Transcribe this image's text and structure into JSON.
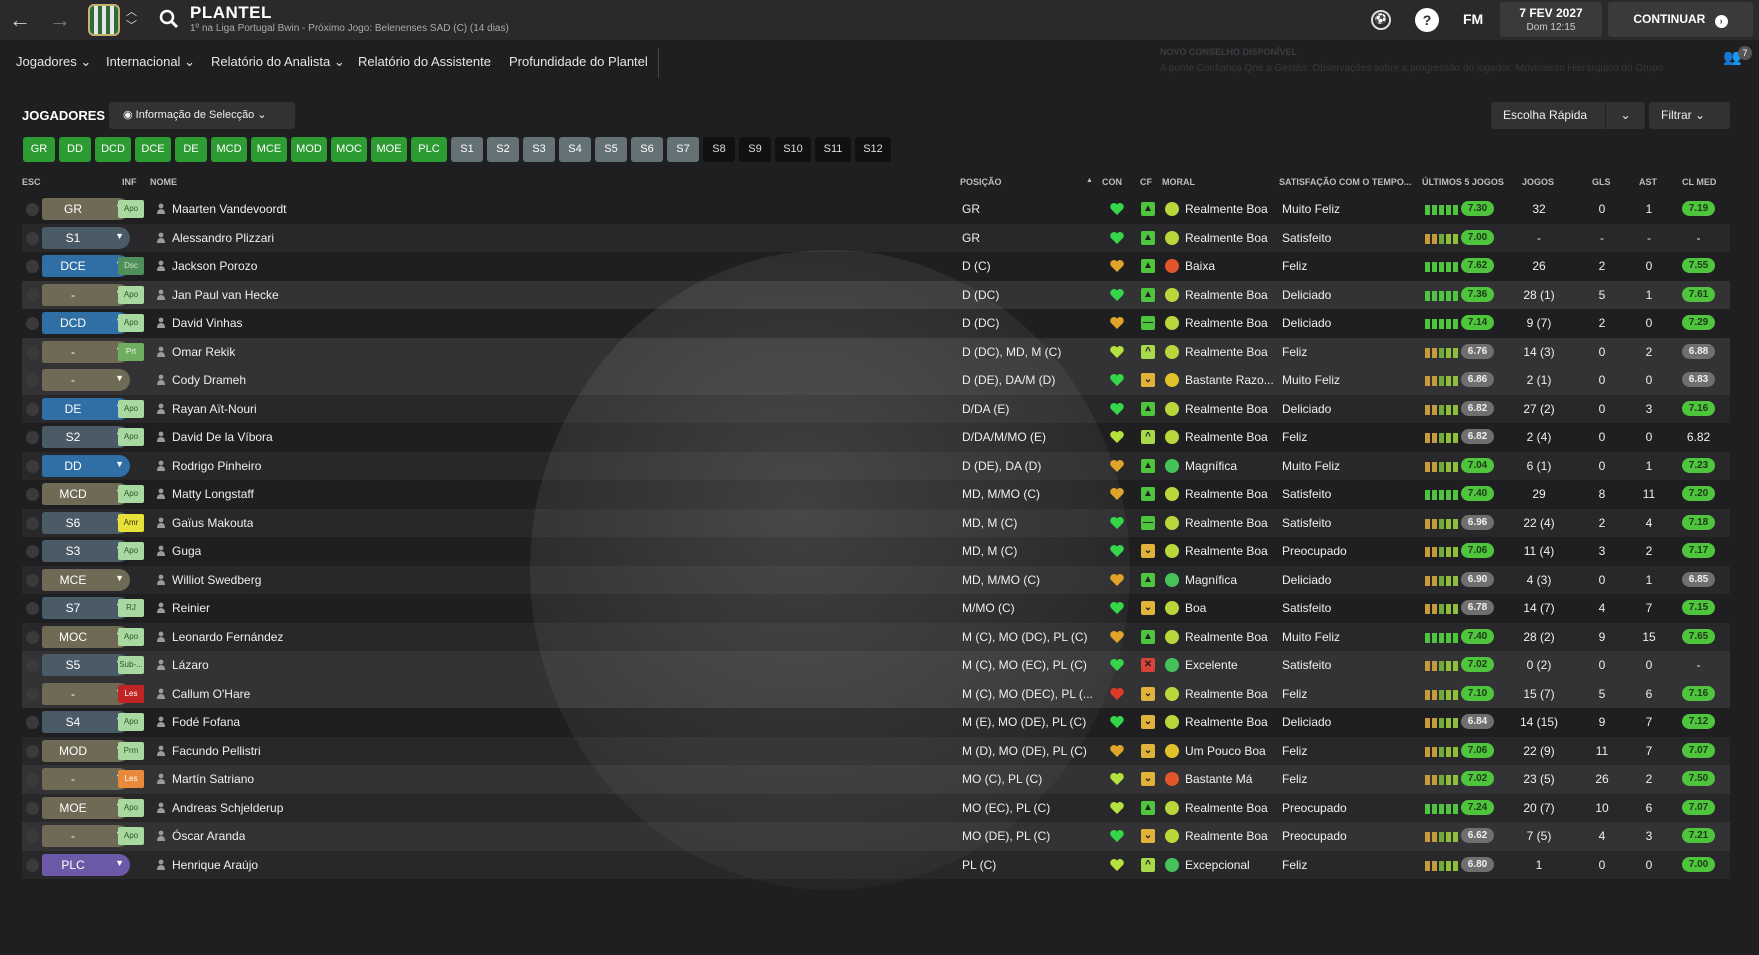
{
  "header": {
    "title": "PLANTEL",
    "subtitle": "1º na Liga Portugal Bwin - Próximo Jogo: Belenenses SAD (C) (14 dias)",
    "fm_label": "FM",
    "date": "7 FEV 2027",
    "day_time": "Dom 12:15",
    "continue_label": "CONTINUAR"
  },
  "menu": {
    "items": [
      "Jogadores",
      "Internacional",
      "Relatório do Analista",
      "Relatório do Assistente",
      "Profundidade do Plantel"
    ]
  },
  "news": {
    "title": "NOVO CONSELHO DISPONÍVEL",
    "text": "A ponte Confiança Qne a Gestão. Observações sobre a progressão do jogador: Movimento Hierárquico do Grupo",
    "badge": "7"
  },
  "players_section": {
    "title": "JOGADORES",
    "view_label": "Informação de Selecção",
    "quick_pick": "Escolha Rápida",
    "filter": "Filtrar"
  },
  "chips": {
    "green": [
      "GR",
      "DD",
      "DCD",
      "DCE",
      "DE",
      "MCD",
      "MCE",
      "MOD",
      "MOC",
      "MOE",
      "PLC"
    ],
    "grey": [
      "S1",
      "S2",
      "S3",
      "S4",
      "S5",
      "S6",
      "S7"
    ],
    "dark": [
      "S8",
      "S9",
      "S10",
      "S11",
      "S12"
    ]
  },
  "columns": {
    "esc": "ESC",
    "inf": "INF",
    "nome": "NOME",
    "posicao": "POSIÇÃO",
    "con": "CON",
    "cf": "CF",
    "moral": "MORAL",
    "satisfacao": "SATISFAÇÃO COM O TEMPO...",
    "ultimos": "ÚLTIMOS 5 JOGOS",
    "jogos": "JOGOS",
    "gls": "GLS",
    "ast": "AST",
    "clmed": "CL MED"
  },
  "colors": {
    "green": "#2c9c33",
    "blue": "#2f6fa5",
    "olive": "#6f6a55",
    "slate": "#4a5a66",
    "purple": "#6c5aa8",
    "rating_green": "#4fc53d",
    "rating_grey": "#6f6f6f"
  },
  "players": [
    {
      "sel": "GR",
      "sel_color": "olive",
      "inf": "Apo",
      "inf_type": "apo",
      "name": "Maarten Vandevoordt",
      "pos": "GR",
      "con": "green",
      "cf": "up",
      "moral_icon": "ok",
      "moral": "Realmente Boa",
      "sat": "Muito Feliz",
      "form": "g5",
      "avg5": "7.30",
      "avg5_type": "green",
      "jogos": "32",
      "gls": "0",
      "ast": "1",
      "cl": "7.19",
      "cl_type": "green"
    },
    {
      "sel": "S1",
      "sel_color": "slate",
      "inf": "",
      "inf_type": "",
      "name": "Alessandro Plizzari",
      "pos": "GR",
      "con": "green",
      "cf": "up",
      "moral_icon": "ok",
      "moral": "Realmente Boa",
      "sat": "Satisfeito",
      "form": "o5",
      "avg5": "7.00",
      "avg5_type": "green",
      "jogos": "-",
      "gls": "-",
      "ast": "-",
      "cl": "-",
      "cl_type": "none"
    },
    {
      "sel": "DCE",
      "sel_color": "blue",
      "inf": "Dsc",
      "inf_type": "dsc",
      "name": "Jackson Porozo",
      "pos": "D (C)",
      "con": "orange",
      "cf": "up",
      "moral_icon": "bad",
      "moral": "Baixa",
      "sat": "Feliz",
      "form": "g5",
      "avg5": "7.62",
      "avg5_type": "green",
      "jogos": "26",
      "gls": "2",
      "ast": "0",
      "cl": "7.55",
      "cl_type": "green"
    },
    {
      "sel": "-",
      "sel_color": "olive",
      "inf": "Apo",
      "inf_type": "apo",
      "name": "Jan Paul van Hecke",
      "pos": "D (DC)",
      "con": "green",
      "cf": "up",
      "moral_icon": "ok",
      "moral": "Realmente Boa",
      "sat": "Deliciado",
      "form": "g5",
      "avg5": "7.36",
      "avg5_type": "green",
      "jogos": "28 (1)",
      "gls": "5",
      "ast": "1",
      "cl": "7.61",
      "cl_type": "green"
    },
    {
      "sel": "DCD",
      "sel_color": "blue",
      "inf": "Apo",
      "inf_type": "apo",
      "name": "David Vinhas",
      "pos": "D (DC)",
      "con": "orange",
      "cf": "flat",
      "moral_icon": "ok",
      "moral": "Realmente Boa",
      "sat": "Deliciado",
      "form": "g5",
      "avg5": "7.14",
      "avg5_type": "green",
      "jogos": "9 (7)",
      "gls": "2",
      "ast": "0",
      "cl": "7.29",
      "cl_type": "green"
    },
    {
      "sel": "-",
      "sel_color": "olive",
      "inf": "Prt",
      "inf_type": "prt",
      "name": "Omar Rekik",
      "pos": "D (DC), MD, M (C)",
      "con": "lime",
      "cf": "upcaret",
      "moral_icon": "ok",
      "moral": "Realmente Boa",
      "sat": "Feliz",
      "form": "o5",
      "avg5": "6.76",
      "avg5_type": "grey",
      "jogos": "14 (3)",
      "gls": "0",
      "ast": "2",
      "cl": "6.88",
      "cl_type": "grey"
    },
    {
      "sel": "-",
      "sel_color": "olive",
      "inf": "",
      "inf_type": "",
      "name": "Cody Drameh",
      "pos": "D (DE), DA/M (D)",
      "con": "green",
      "cf": "down",
      "moral_icon": "meh",
      "moral": "Bastante Razo...",
      "sat": "Muito Feliz",
      "form": "o5",
      "avg5": "6.86",
      "avg5_type": "grey",
      "jogos": "2 (1)",
      "gls": "0",
      "ast": "0",
      "cl": "6.83",
      "cl_type": "grey"
    },
    {
      "sel": "DE",
      "sel_color": "blue",
      "inf": "Apo",
      "inf_type": "apo",
      "name": "Rayan Aït-Nouri",
      "pos": "D/DA (E)",
      "con": "green",
      "cf": "up",
      "moral_icon": "ok",
      "moral": "Realmente Boa",
      "sat": "Deliciado",
      "form": "o5",
      "avg5": "6.82",
      "avg5_type": "grey",
      "jogos": "27 (2)",
      "gls": "0",
      "ast": "3",
      "cl": "7.16",
      "cl_type": "green"
    },
    {
      "sel": "S2",
      "sel_color": "slate",
      "inf": "Apo",
      "inf_type": "apo",
      "name": "David De la Víbora",
      "pos": "D/DA/M/MO (E)",
      "con": "lime",
      "cf": "upcaret",
      "moral_icon": "ok",
      "moral": "Realmente Boa",
      "sat": "Feliz",
      "form": "o5",
      "avg5": "6.82",
      "avg5_type": "grey",
      "jogos": "2 (4)",
      "gls": "0",
      "ast": "0",
      "cl": "6.82",
      "cl_type": "plain"
    },
    {
      "sel": "DD",
      "sel_color": "blue",
      "inf": "",
      "inf_type": "",
      "name": "Rodrigo Pinheiro",
      "pos": "D (DE), DA (D)",
      "con": "orange",
      "cf": "up",
      "moral_icon": "great",
      "moral": "Magnífica",
      "sat": "Muito Feliz",
      "form": "o5",
      "avg5": "7.04",
      "avg5_type": "green",
      "jogos": "6 (1)",
      "gls": "0",
      "ast": "1",
      "cl": "7.23",
      "cl_type": "green"
    },
    {
      "sel": "MCD",
      "sel_color": "olive",
      "inf": "Apo",
      "inf_type": "apo",
      "name": "Matty Longstaff",
      "pos": "MD, M/MO (C)",
      "con": "orange",
      "cf": "up",
      "moral_icon": "ok",
      "moral": "Realmente Boa",
      "sat": "Satisfeito",
      "form": "g5",
      "avg5": "7.40",
      "avg5_type": "green",
      "jogos": "29",
      "gls": "8",
      "ast": "11",
      "cl": "7.20",
      "cl_type": "green"
    },
    {
      "sel": "S6",
      "sel_color": "slate",
      "inf": "Amr",
      "inf_type": "amr",
      "name": "Gaïus Makouta",
      "pos": "MD, M (C)",
      "con": "green",
      "cf": "flat",
      "moral_icon": "ok",
      "moral": "Realmente Boa",
      "sat": "Satisfeito",
      "form": "o5",
      "avg5": "6.96",
      "avg5_type": "grey",
      "jogos": "22 (4)",
      "gls": "2",
      "ast": "4",
      "cl": "7.18",
      "cl_type": "green"
    },
    {
      "sel": "S3",
      "sel_color": "slate",
      "inf": "Apo",
      "inf_type": "apo",
      "name": "Guga",
      "pos": "MD, M (C)",
      "con": "green",
      "cf": "down",
      "moral_icon": "ok",
      "moral": "Realmente Boa",
      "sat": "Preocupado",
      "form": "o5",
      "avg5": "7.06",
      "avg5_type": "green",
      "jogos": "11 (4)",
      "gls": "3",
      "ast": "2",
      "cl": "7.17",
      "cl_type": "green"
    },
    {
      "sel": "MCE",
      "sel_color": "olive",
      "inf": "",
      "inf_type": "",
      "name": "Williot Swedberg",
      "pos": "MD, M/MO (C)",
      "con": "orange",
      "cf": "up",
      "moral_icon": "great",
      "moral": "Magnífica",
      "sat": "Deliciado",
      "form": "o5",
      "avg5": "6.90",
      "avg5_type": "grey",
      "jogos": "4 (3)",
      "gls": "0",
      "ast": "1",
      "cl": "6.85",
      "cl_type": "grey"
    },
    {
      "sel": "S7",
      "sel_color": "slate",
      "inf": "RJ",
      "inf_type": "rj",
      "name": "Reinier",
      "pos": "M/MO (C)",
      "con": "green",
      "cf": "down",
      "moral_icon": "ok",
      "moral": "Boa",
      "sat": "Satisfeito",
      "form": "o5",
      "avg5": "6.78",
      "avg5_type": "grey",
      "jogos": "14 (7)",
      "gls": "4",
      "ast": "7",
      "cl": "7.15",
      "cl_type": "green"
    },
    {
      "sel": "MOC",
      "sel_color": "olive",
      "inf": "Apo",
      "inf_type": "apo",
      "name": "Leonardo Fernández",
      "pos": "M (C), MO (DC), PL (C)",
      "con": "orange",
      "cf": "up",
      "moral_icon": "ok",
      "moral": "Realmente Boa",
      "sat": "Muito Feliz",
      "form": "g5",
      "avg5": "7.40",
      "avg5_type": "green",
      "jogos": "28 (2)",
      "gls": "9",
      "ast": "15",
      "cl": "7.65",
      "cl_type": "green"
    },
    {
      "sel": "S5",
      "sel_color": "slate",
      "inf": "Sub-...",
      "inf_type": "sub",
      "name": "Lázaro",
      "pos": "M (C), MO (EC), PL (C)",
      "con": "green",
      "cf": "red",
      "moral_icon": "great",
      "moral": "Excelente",
      "sat": "Satisfeito",
      "form": "o5",
      "avg5": "7.02",
      "avg5_type": "green",
      "jogos": "0 (2)",
      "gls": "0",
      "ast": "0",
      "cl": "-",
      "cl_type": "none"
    },
    {
      "sel": "-",
      "sel_color": "olive",
      "inf": "Les",
      "inf_type": "les",
      "name": "Callum O'Hare",
      "pos": "M (C), MO (DEC), PL (...",
      "con": "red",
      "cf": "down",
      "moral_icon": "ok",
      "moral": "Realmente Boa",
      "sat": "Feliz",
      "form": "o5",
      "avg5": "7.10",
      "avg5_type": "green",
      "jogos": "15 (7)",
      "gls": "5",
      "ast": "6",
      "cl": "7.16",
      "cl_type": "green"
    },
    {
      "sel": "S4",
      "sel_color": "slate",
      "inf": "Apo",
      "inf_type": "apo",
      "name": "Fodé Fofana",
      "pos": "M (E), MO (DE), PL (C)",
      "con": "green",
      "cf": "down",
      "moral_icon": "ok",
      "moral": "Realmente Boa",
      "sat": "Deliciado",
      "form": "o5",
      "avg5": "6.84",
      "avg5_type": "grey",
      "jogos": "14 (15)",
      "gls": "9",
      "ast": "7",
      "cl": "7.12",
      "cl_type": "green"
    },
    {
      "sel": "MOD",
      "sel_color": "olive",
      "inf": "Prm",
      "inf_type": "prm",
      "name": "Facundo Pellistri",
      "pos": "M (D), MO (DE), PL (C)",
      "con": "orange",
      "cf": "down",
      "moral_icon": "meh",
      "moral": "Um Pouco Boa",
      "sat": "Feliz",
      "form": "o5",
      "avg5": "7.06",
      "avg5_type": "green",
      "jogos": "22 (9)",
      "gls": "11",
      "ast": "7",
      "cl": "7.07",
      "cl_type": "green"
    },
    {
      "sel": "-",
      "sel_color": "olive",
      "inf": "Les",
      "inf_type": "les2",
      "name": "Martín Satriano",
      "pos": "MO (C), PL (C)",
      "con": "lime",
      "cf": "down",
      "moral_icon": "bad",
      "moral": "Bastante Má",
      "sat": "Feliz",
      "form": "o5",
      "avg5": "7.02",
      "avg5_type": "green",
      "jogos": "23 (5)",
      "gls": "26",
      "ast": "2",
      "cl": "7.50",
      "cl_type": "green"
    },
    {
      "sel": "MOE",
      "sel_color": "olive",
      "inf": "Apo",
      "inf_type": "apo",
      "name": "Andreas Schjelderup",
      "pos": "MO (EC), PL (C)",
      "con": "lime",
      "cf": "up",
      "moral_icon": "ok",
      "moral": "Realmente Boa",
      "sat": "Preocupado",
      "form": "g5",
      "avg5": "7.24",
      "avg5_type": "green",
      "jogos": "20 (7)",
      "gls": "10",
      "ast": "6",
      "cl": "7.07",
      "cl_type": "green"
    },
    {
      "sel": "-",
      "sel_color": "olive",
      "inf": "Apo",
      "inf_type": "apo",
      "name": "Óscar Aranda",
      "pos": "MO (DE), PL (C)",
      "con": "green",
      "cf": "down",
      "moral_icon": "ok",
      "moral": "Realmente Boa",
      "sat": "Preocupado",
      "form": "o5",
      "avg5": "6.62",
      "avg5_type": "grey",
      "jogos": "7 (5)",
      "gls": "4",
      "ast": "3",
      "cl": "7.21",
      "cl_type": "green"
    },
    {
      "sel": "PLC",
      "sel_color": "purple",
      "inf": "",
      "inf_type": "",
      "name": "Henrique Araújo",
      "pos": "PL (C)",
      "con": "lime",
      "cf": "upcaret",
      "moral_icon": "great",
      "moral": "Excepcional",
      "sat": "Feliz",
      "form": "o5",
      "avg5": "6.80",
      "avg5_type": "grey",
      "jogos": "1",
      "gls": "0",
      "ast": "0",
      "cl": "7.00",
      "cl_type": "green"
    }
  ]
}
